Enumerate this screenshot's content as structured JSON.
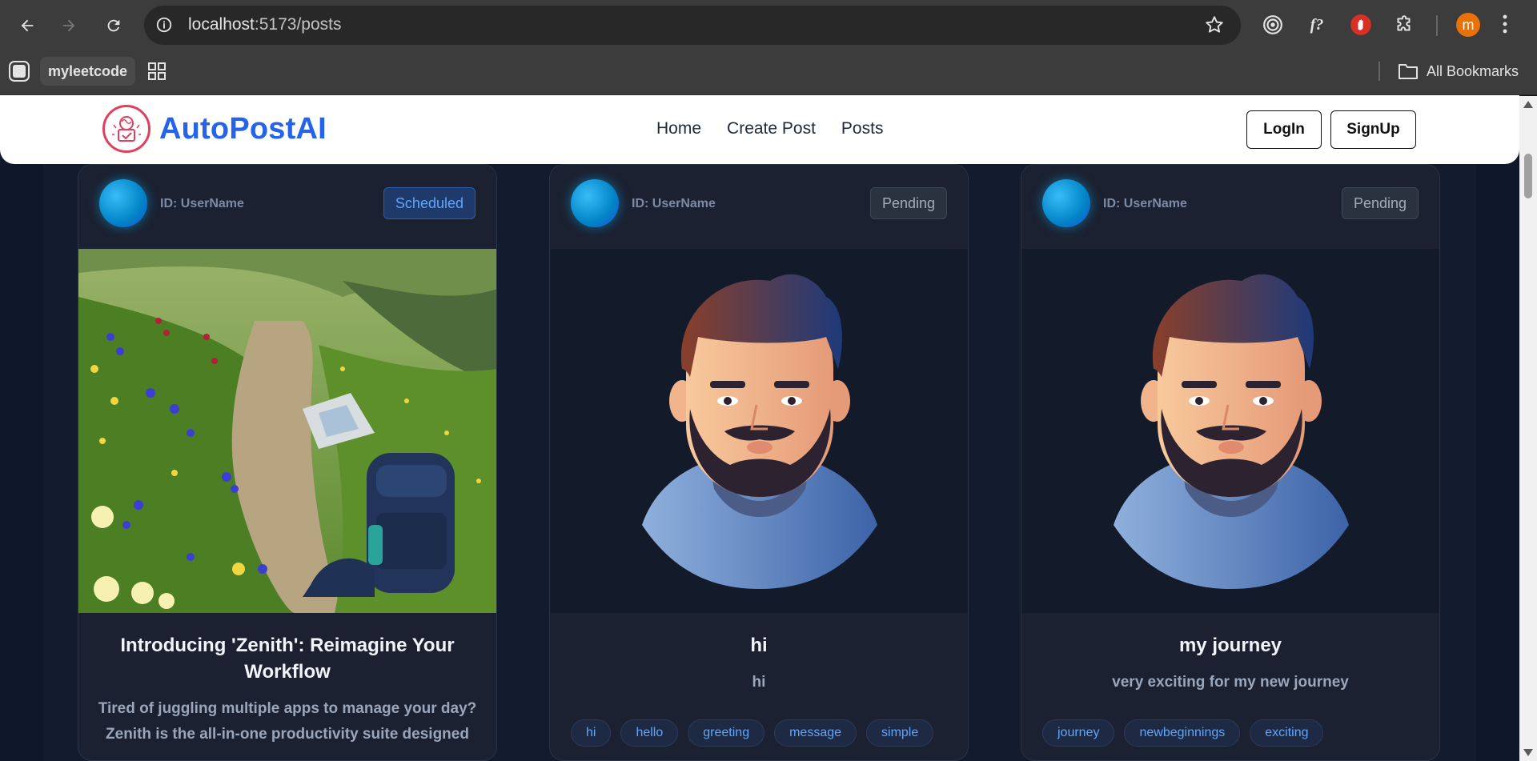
{
  "browser": {
    "url_host": "localhost",
    "url_path": ":5173/posts",
    "bookmarks": {
      "group_label": "myleetcode",
      "all_bookmarks": "All Bookmarks"
    },
    "profile_initial": "m",
    "extension_f": "f?"
  },
  "header": {
    "brand": "AutoPostAI",
    "nav": [
      "Home",
      "Create Post",
      "Posts"
    ],
    "login": "LogIn",
    "signup": "SignUp"
  },
  "posts": [
    {
      "user": "ID: UserName",
      "status": "Scheduled",
      "image": "mountain-trail-backpack",
      "title": "Introducing 'Zenith': Reimagine Your Workflow",
      "description": "Tired of juggling multiple apps to manage your day? Zenith is the all-in-one productivity suite designed",
      "tags": []
    },
    {
      "user": "ID: UserName",
      "status": "Pending",
      "image": "bearded-man-avatar",
      "title": "hi",
      "description": "hi",
      "tags": [
        "hi",
        "hello",
        "greeting",
        "message",
        "simple"
      ]
    },
    {
      "user": "ID: UserName",
      "status": "Pending",
      "image": "bearded-man-avatar",
      "title": "my journey",
      "description": "very exciting for my new journey",
      "tags": [
        "journey",
        "newbeginnings",
        "exciting"
      ]
    }
  ],
  "colors": {
    "accent": "#2563eb",
    "page_bg": "#0f172a",
    "card_bg": "#1b2130",
    "tag_text": "#60a5fa"
  }
}
